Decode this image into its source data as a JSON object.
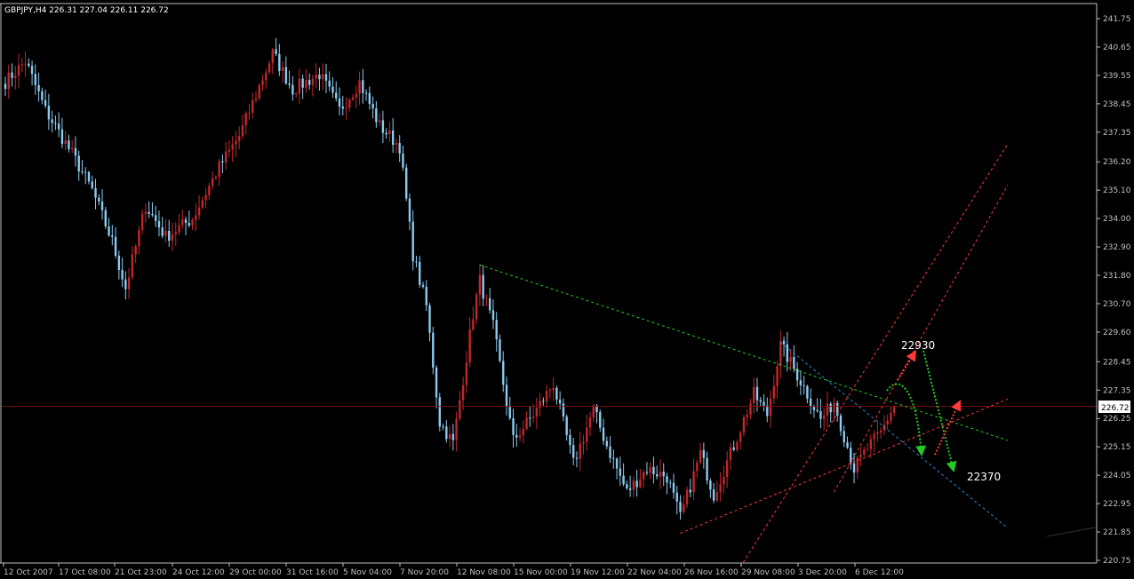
{
  "window": {
    "header": "GBPJPY,H4  226.31 227.04 226.11 226.72"
  },
  "colors": {
    "background": "#000000",
    "axis": "#c0c0c0",
    "bull": "#c0282c",
    "bear": "#8ccaf0",
    "price_line": "#7a1010",
    "price_badge": "#ffffff",
    "trend_green": "#22cc22",
    "trend_red": "#ff3a3a",
    "trend_blue": "#2a8ad8"
  },
  "chart_data": {
    "type": "candlestick",
    "symbol": "GBPJPY",
    "timeframe": "H4",
    "last_price_label": "226.72",
    "last_price": 226.72,
    "ylim": [
      220.4,
      242.2
    ],
    "y_ticks": [
      "241.75",
      "240.65",
      "239.55",
      "238.45",
      "237.35",
      "236.20",
      "235.10",
      "234.00",
      "232.90",
      "231.80",
      "230.70",
      "229.60",
      "228.45",
      "227.35",
      "226.25",
      "225.15",
      "224.05",
      "222.95",
      "221.85",
      "220.75"
    ],
    "x_ticks": [
      "12 Oct 2007",
      "17 Oct 08:00",
      "21 Oct 23:00",
      "24 Oct 12:00",
      "29 Oct 00:00",
      "31 Oct 16:00",
      "5 Nov 04:00",
      "7 Nov 20:00",
      "12 Nov 08:00",
      "15 Nov 00:00",
      "19 Nov 12:00",
      "22 Nov 04:00",
      "26 Nov 16:00",
      "29 Nov 08:00",
      "3 Dec 20:00",
      "6 Dec 12:00"
    ],
    "anchors": [
      [
        0,
        239.3
      ],
      [
        6,
        240.1
      ],
      [
        12,
        238.2
      ],
      [
        20,
        236.5
      ],
      [
        26,
        235.1
      ],
      [
        32,
        233.1
      ],
      [
        36,
        231.3
      ],
      [
        42,
        234.5
      ],
      [
        48,
        233.3
      ],
      [
        56,
        234.0
      ],
      [
        64,
        236.0
      ],
      [
        70,
        237.2
      ],
      [
        80,
        240.4
      ],
      [
        86,
        239.0
      ],
      [
        94,
        239.6
      ],
      [
        100,
        238.2
      ],
      [
        106,
        239.3
      ],
      [
        112,
        237.6
      ],
      [
        118,
        236.8
      ],
      [
        122,
        232.6
      ],
      [
        126,
        230.6
      ],
      [
        130,
        226.1
      ],
      [
        134,
        225.3
      ],
      [
        140,
        230.3
      ],
      [
        142,
        231.6
      ],
      [
        146,
        229.8
      ],
      [
        152,
        225.4
      ],
      [
        158,
        226.4
      ],
      [
        164,
        227.6
      ],
      [
        170,
        224.5
      ],
      [
        176,
        226.6
      ],
      [
        180,
        225.2
      ],
      [
        186,
        223.4
      ],
      [
        192,
        224.3
      ],
      [
        198,
        224.0
      ],
      [
        202,
        222.4
      ],
      [
        208,
        224.9
      ],
      [
        212,
        223.3
      ],
      [
        218,
        225.2
      ],
      [
        224,
        227.2
      ],
      [
        228,
        226.4
      ],
      [
        232,
        229.1
      ],
      [
        238,
        227.7
      ],
      [
        244,
        226.2
      ],
      [
        248,
        226.9
      ],
      [
        254,
        224.3
      ],
      [
        258,
        225.1
      ],
      [
        262,
        225.7
      ],
      [
        266,
        226.8
      ]
    ],
    "annotations": {
      "level_high": "22930",
      "level_low": "22370"
    },
    "trendlines": [
      {
        "name": "upper-resistance",
        "color": "green",
        "style": "dashed",
        "from": [
          142,
          232.2
        ],
        "to": [
          300,
          225.4
        ]
      },
      {
        "name": "lower-support",
        "color": "red",
        "style": "dashed",
        "from": [
          202,
          221.8
        ],
        "to": [
          300,
          227.0
        ]
      },
      {
        "name": "channel-upper",
        "color": "red",
        "style": "dashed",
        "from": [
          220,
          220.5
        ],
        "to": [
          300,
          236.9
        ]
      },
      {
        "name": "channel-lower",
        "color": "red",
        "style": "dashed",
        "from": [
          248,
          223.4
        ],
        "to": [
          300,
          235.3
        ]
      },
      {
        "name": "short-resistance",
        "color": "blue",
        "style": "dashed",
        "from": [
          232,
          229.2
        ],
        "to": [
          300,
          222.0
        ]
      }
    ]
  }
}
